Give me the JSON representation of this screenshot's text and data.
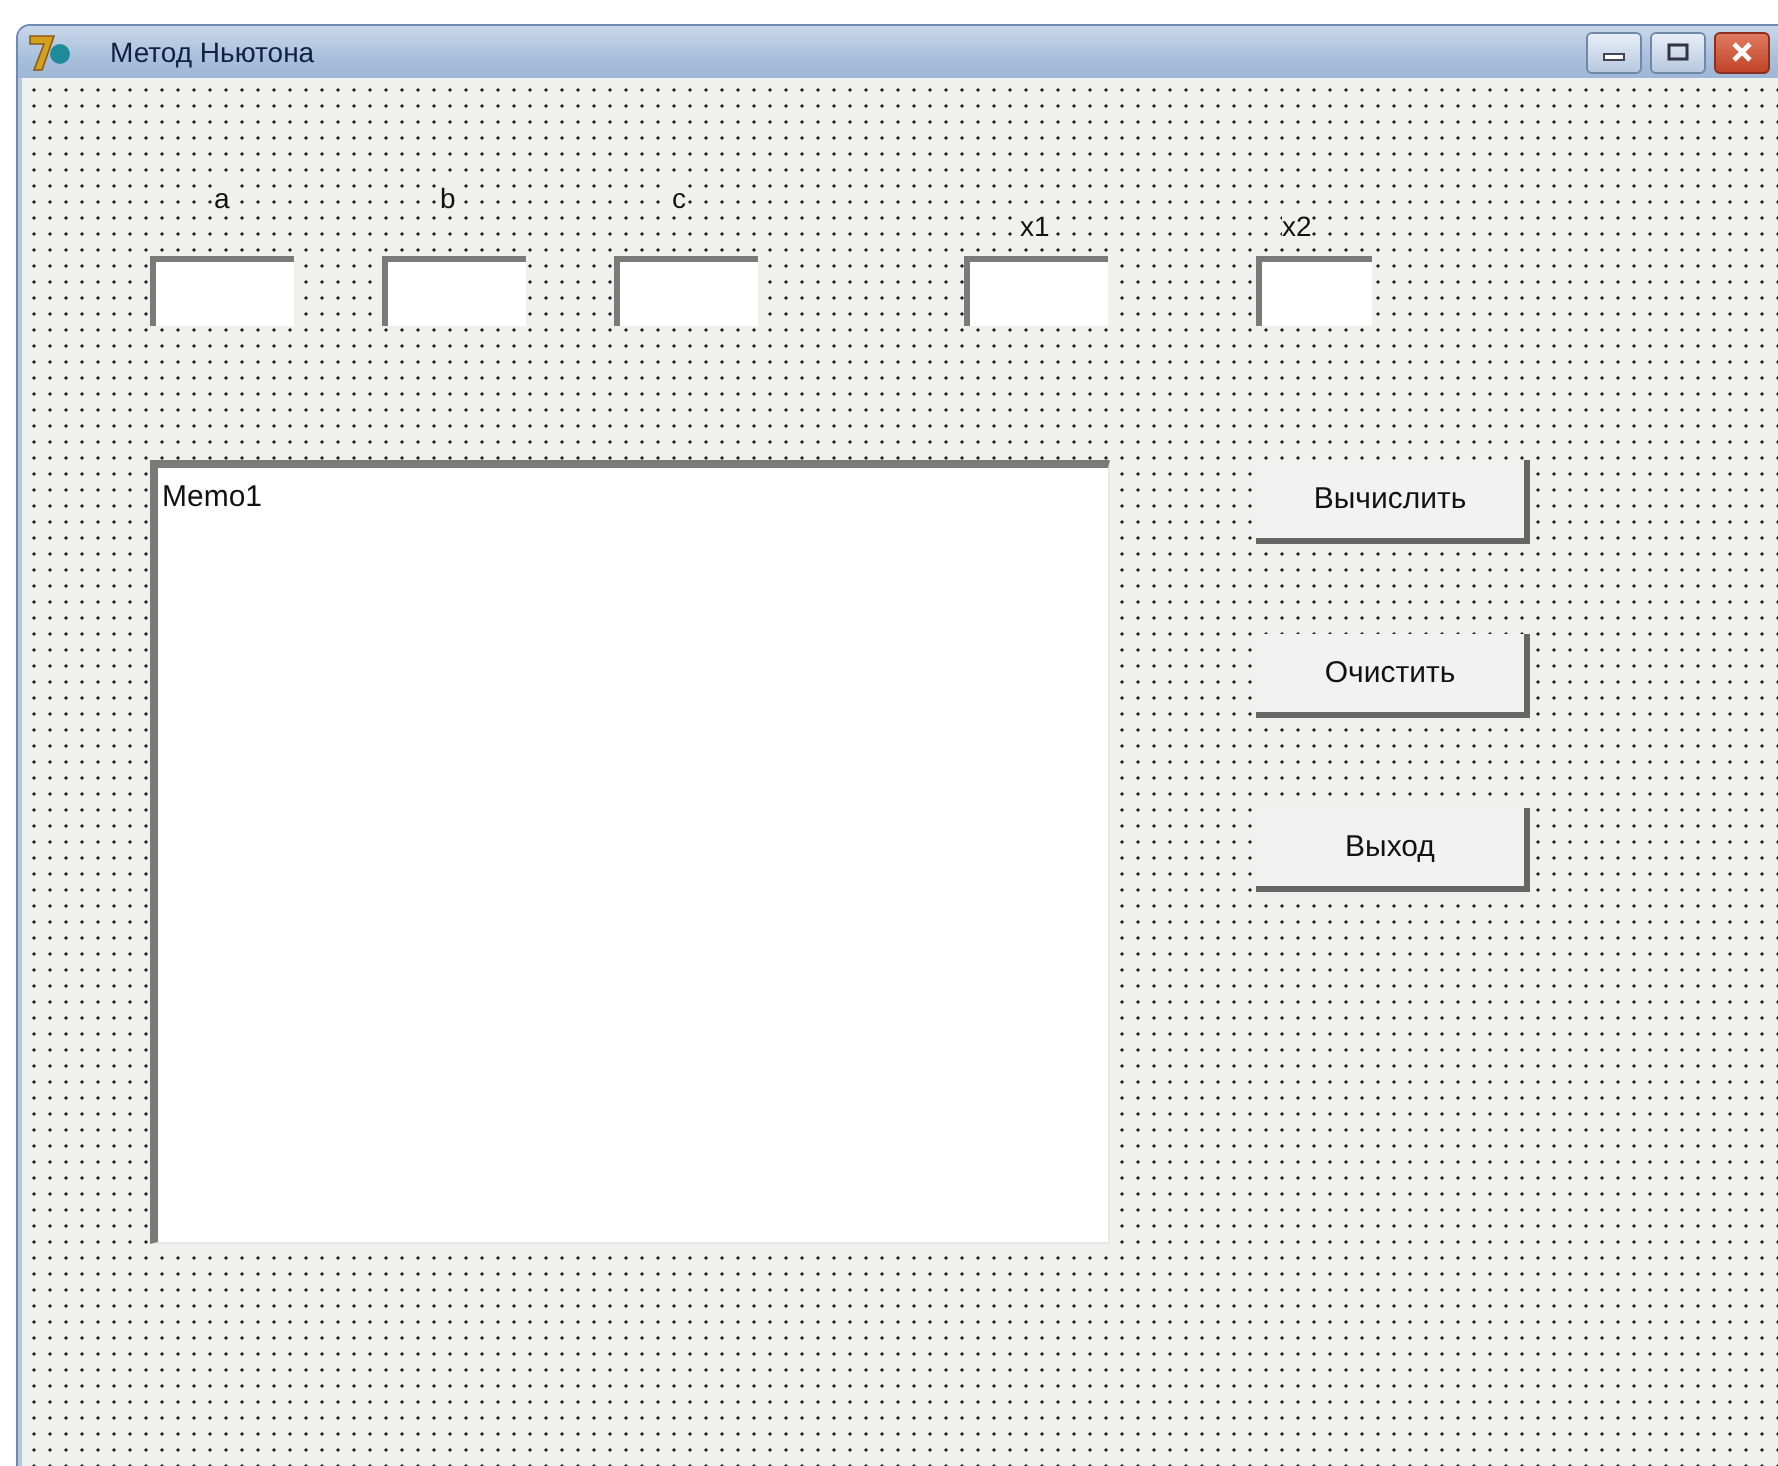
{
  "window": {
    "title": "Метод Ньютона"
  },
  "labels": [
    {
      "text": "a"
    },
    {
      "text": "b"
    },
    {
      "text": "c"
    },
    {
      "text": "x1"
    },
    {
      "text": "x2"
    }
  ],
  "memo": {
    "text": "Memo1"
  },
  "buttons": [
    "Вычислить",
    "Очистить",
    "Выход"
  ]
}
